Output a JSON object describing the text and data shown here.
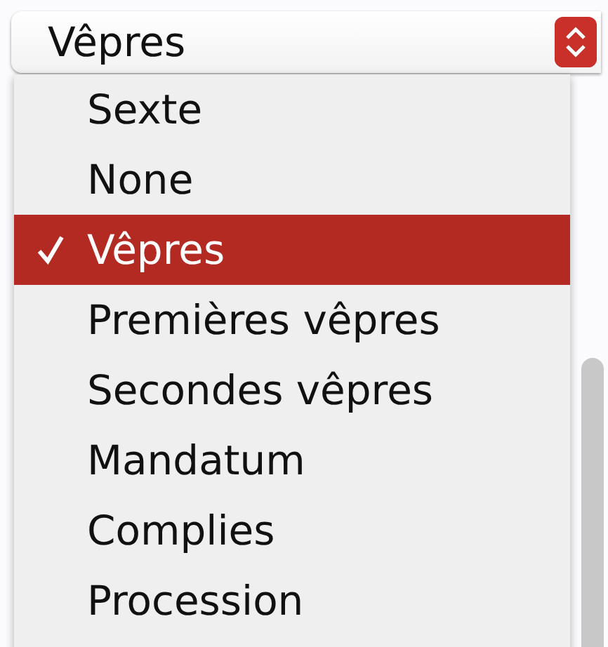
{
  "select": {
    "value": "Vêpres"
  },
  "menu": {
    "items": [
      {
        "label": "Sexte",
        "selected": false
      },
      {
        "label": "None",
        "selected": false
      },
      {
        "label": "Vêpres",
        "selected": true
      },
      {
        "label": "Premières vêpres",
        "selected": false
      },
      {
        "label": "Secondes vêpres",
        "selected": false
      },
      {
        "label": "Mandatum",
        "selected": false
      },
      {
        "label": "Complies",
        "selected": false
      },
      {
        "label": "Procession",
        "selected": false
      }
    ]
  }
}
